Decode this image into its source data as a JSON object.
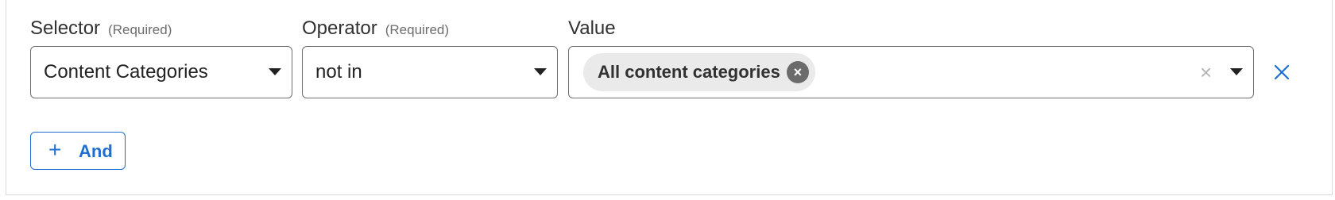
{
  "selector": {
    "label": "Selector",
    "required_note": "(Required)",
    "value": "Content Categories"
  },
  "operator": {
    "label": "Operator",
    "required_note": "(Required)",
    "value": "not in"
  },
  "value_field": {
    "label": "Value",
    "chips": [
      "All content categories"
    ],
    "chip_remove_glyph": "×",
    "clear_glyph": "×"
  },
  "remove_row": {
    "icon": "close-icon",
    "color": "#1f6fd1"
  },
  "and_button": {
    "plus_glyph": "+",
    "label": "And"
  },
  "colors": {
    "accent": "#1f6fd1",
    "chip_bg": "#eaeaea",
    "border": "#6e6e6e"
  }
}
